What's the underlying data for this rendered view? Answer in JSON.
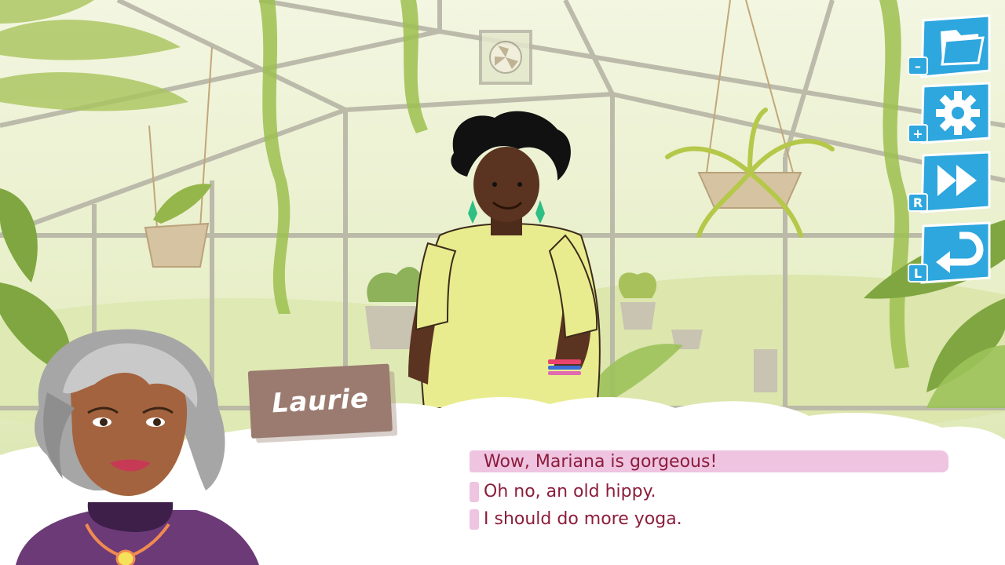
{
  "speaker": {
    "name": "Laurie"
  },
  "dialogue": {
    "choices": [
      {
        "text": "Wow, Mariana is gorgeous!",
        "selected": true
      },
      {
        "text": "Oh no, an old hippy.",
        "selected": false
      },
      {
        "text": "I should do more yoga.",
        "selected": false
      }
    ]
  },
  "menu": {
    "buttons": [
      {
        "icon": "folder-icon",
        "hint": "–"
      },
      {
        "icon": "gear-icon",
        "hint": "+"
      },
      {
        "icon": "fast-forward-icon",
        "hint": "R"
      },
      {
        "icon": "return-arrow-icon",
        "hint": "L"
      }
    ]
  },
  "colors": {
    "menu_blue": "#2ea6de",
    "choice_text": "#8c1d3b",
    "choice_highlight": "#eec4e1",
    "name_tag": "#9b7b70"
  }
}
